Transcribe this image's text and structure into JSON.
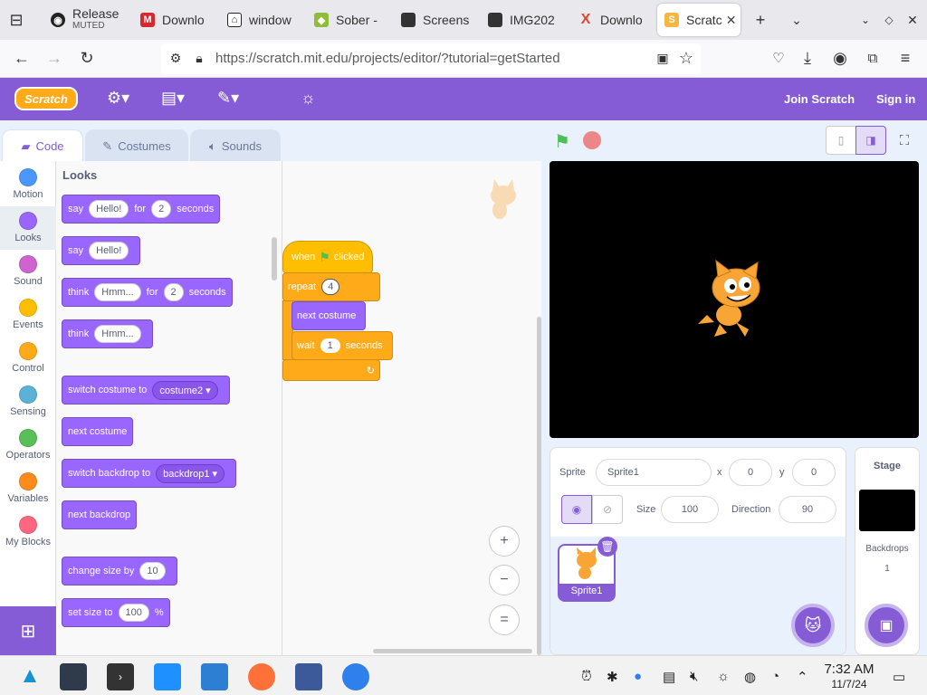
{
  "tabs": [
    {
      "title": "Release",
      "subtitle": "MUTED",
      "icon": "github-icon"
    },
    {
      "title": "Downlo",
      "icon": "mega-icon"
    },
    {
      "title": "window",
      "icon": "bank-icon"
    },
    {
      "title": "Sober -",
      "icon": "sober-icon"
    },
    {
      "title": "Screens",
      "icon": "image-icon"
    },
    {
      "title": "IMG202",
      "icon": "image-icon"
    },
    {
      "title": "Downlo",
      "icon": "x-logo-icon"
    },
    {
      "title": "Scratc",
      "icon": "scratch-icon",
      "active": true
    }
  ],
  "browser": {
    "url": "https://scratch.mit.edu/projects/editor/?tutorial=getStarted"
  },
  "menubar": {
    "logo": "Scratch",
    "join": "Join Scratch",
    "signin": "Sign in"
  },
  "editor_tabs": {
    "code": "Code",
    "costumes": "Costumes",
    "sounds": "Sounds"
  },
  "categories": [
    {
      "label": "Motion",
      "color": "#4c97ff"
    },
    {
      "label": "Looks",
      "color": "#9966ff",
      "selected": true
    },
    {
      "label": "Sound",
      "color": "#cf63cf"
    },
    {
      "label": "Events",
      "color": "#ffbf00"
    },
    {
      "label": "Control",
      "color": "#ffab19"
    },
    {
      "label": "Sensing",
      "color": "#5cb1d6"
    },
    {
      "label": "Operators",
      "color": "#59c059"
    },
    {
      "label": "Variables",
      "color": "#ff8c1a"
    },
    {
      "label": "My Blocks",
      "color": "#ff6680"
    }
  ],
  "palette": {
    "heading": "Looks",
    "say_for": {
      "w1": "say",
      "v1": "Hello!",
      "w2": "for",
      "v2": "2",
      "w3": "seconds"
    },
    "say": {
      "w1": "say",
      "v1": "Hello!"
    },
    "think_for": {
      "w1": "think",
      "v1": "Hmm...",
      "w2": "for",
      "v2": "2",
      "w3": "seconds"
    },
    "think": {
      "w1": "think",
      "v1": "Hmm..."
    },
    "switch_costume": {
      "w1": "switch costume to",
      "v1": "costume2"
    },
    "next_costume": "next costume",
    "switch_backdrop": {
      "w1": "switch backdrop to",
      "v1": "backdrop1"
    },
    "next_backdrop": "next backdrop",
    "change_size": {
      "w1": "change size by",
      "v1": "10"
    },
    "set_size": {
      "w1": "set size to",
      "v1": "100",
      "w2": "%"
    }
  },
  "script": {
    "hat": {
      "w1": "when",
      "w2": "clicked"
    },
    "repeat": {
      "w1": "repeat",
      "v1": "4"
    },
    "next_costume": "next costume",
    "wait": {
      "w1": "wait",
      "v1": "1",
      "w2": "seconds"
    },
    "zoom_in": "+",
    "zoom_out": "−",
    "zoom_reset": "="
  },
  "sprite_info": {
    "sprite_label": "Sprite",
    "sprite_name": "Sprite1",
    "x_label": "x",
    "x": "0",
    "y_label": "y",
    "y": "0",
    "size_label": "Size",
    "size": "100",
    "direction_label": "Direction",
    "direction": "90",
    "thumb_name": "Sprite1"
  },
  "stage_panel": {
    "title": "Stage",
    "backdrops_label": "Backdrops",
    "backdrops_count": "1"
  },
  "clock": {
    "time": "7:32 AM",
    "date": "11/7/24"
  }
}
